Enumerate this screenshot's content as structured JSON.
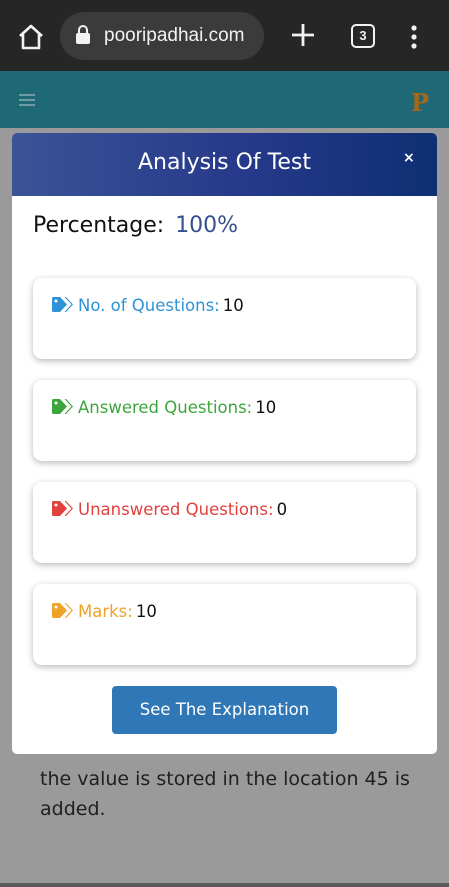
{
  "browser": {
    "url": "pooripadhai.com",
    "tab_count": "3"
  },
  "site": {
    "logo_letter": "P",
    "background_text": "the value is stored in the location 45 is added."
  },
  "modal": {
    "title": "Analysis Of Test",
    "close_label": "×",
    "percentage_label": "Percentage:",
    "percentage_value": "100%",
    "stats": [
      {
        "label": "No. of Questions:",
        "value": "10",
        "color": "#2e93d6",
        "icon": "tag-icon"
      },
      {
        "label": "Answered Questions:",
        "value": "10",
        "color": "#3ca63c",
        "icon": "tag-icon"
      },
      {
        "label": "Unanswered Questions:",
        "value": "0",
        "color": "#e2413c",
        "icon": "tag-icon"
      },
      {
        "label": "Marks:",
        "value": "10",
        "color": "#f0a22a",
        "icon": "tag-icon"
      }
    ],
    "button_label": "See The Explanation"
  },
  "colors": {
    "header_gradient_start": "#3b5397",
    "header_gradient_end": "#0e2f73",
    "button": "#2f77b6",
    "percentage_value": "#35508f"
  }
}
